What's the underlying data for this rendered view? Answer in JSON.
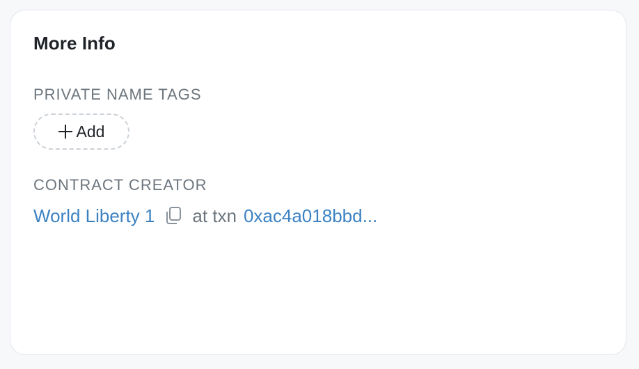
{
  "card": {
    "title": "More Info"
  },
  "private_name_tags": {
    "label": "PRIVATE NAME TAGS",
    "add_button_label": "Add",
    "add_icon": "plus-icon"
  },
  "contract_creator": {
    "label": "CONTRACT CREATOR",
    "creator_name": "World Liberty 1",
    "copy_icon": "copy-icon",
    "at_txn_text": "at txn",
    "txn_hash": "0xac4a018bbd..."
  },
  "colors": {
    "link": "#3c82c2",
    "label_gray": "#6c757d",
    "title": "#1f2328",
    "card_border": "#e3e6ea",
    "page_bg": "#f7f8fa"
  }
}
